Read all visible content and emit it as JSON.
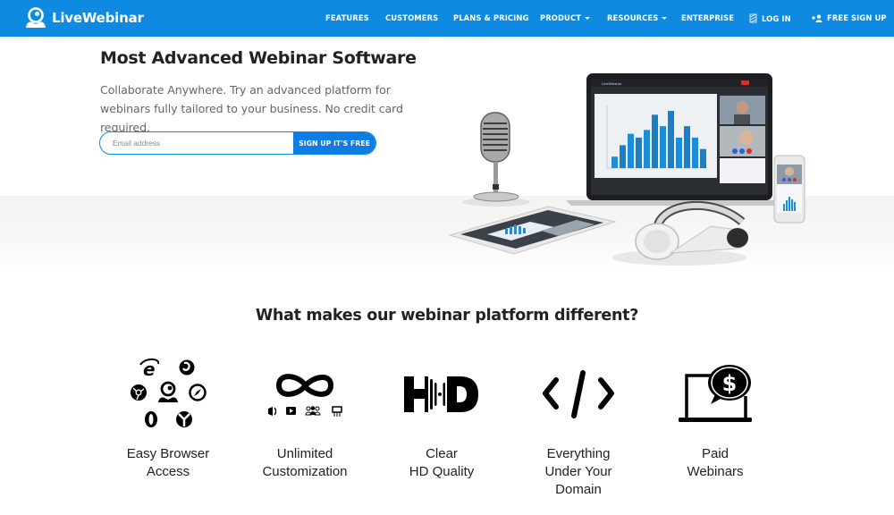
{
  "nav": {
    "brand": "LiveWebinar",
    "items": [
      {
        "label": "FEATURES",
        "dropdown": false
      },
      {
        "label": "CUSTOMERS",
        "dropdown": false
      },
      {
        "label": "PLANS & PRICING",
        "dropdown": false
      },
      {
        "label": "PRODUCT",
        "dropdown": true
      },
      {
        "label": "RESOURCES",
        "dropdown": true
      },
      {
        "label": "ENTERPRISE",
        "dropdown": false
      }
    ],
    "login": {
      "label": "LOG IN",
      "icon": "login-icon"
    },
    "signup": {
      "label": "FREE SIGN UP",
      "icon": "add-user-icon"
    }
  },
  "hero": {
    "title": "Most Advanced Webinar Software",
    "subtitle": "Collaborate Anywhere. Try an advanced platform for webinars fully tailored to your business. No credit card required.",
    "email_placeholder": "Email address",
    "email_value": "",
    "cta_label": "SIGN UP IT'S FREE",
    "illustration": "devices-illustration"
  },
  "features": {
    "title": "What makes our webinar platform different?",
    "items": [
      {
        "label_lines": [
          "Easy Browser",
          "Access"
        ],
        "icon": "browsers-icon"
      },
      {
        "label_lines": [
          "Unlimited",
          "Customization"
        ],
        "icon": "infinity-icon"
      },
      {
        "label_lines": [
          "Clear",
          "HD Quality"
        ],
        "icon": "hd-icon"
      },
      {
        "label_lines": [
          "Everything",
          "Under Your",
          "Domain"
        ],
        "icon": "code-icon"
      },
      {
        "label_lines": [
          "Paid",
          "Webinars"
        ],
        "icon": "paid-laptop-icon"
      }
    ]
  },
  "colors": {
    "brand": "#0e8ae0",
    "cta": "#0e7ce3",
    "chart_bars": "#1a8fd8"
  },
  "illustration_chart": {
    "values": [
      3,
      6,
      9,
      8,
      10,
      14,
      11,
      15,
      8,
      11,
      8,
      5
    ]
  }
}
